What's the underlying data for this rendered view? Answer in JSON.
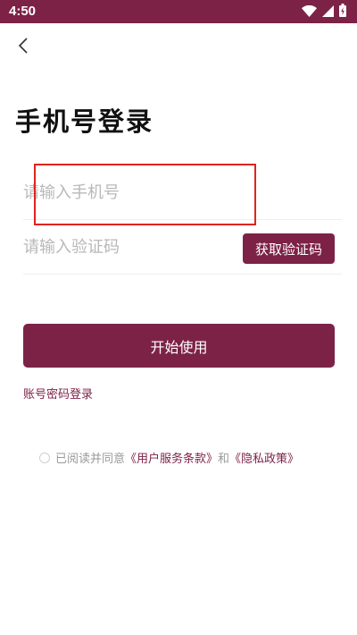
{
  "status_bar": {
    "time": "4:50"
  },
  "page": {
    "title": "手机号登录"
  },
  "phone_field": {
    "placeholder": "请输入手机号"
  },
  "code_field": {
    "placeholder": "请输入验证码",
    "send_button_label": "获取验证码"
  },
  "start_button_label": "开始使用",
  "password_login_label": "账号密码登录",
  "agreement": {
    "prefix": "已阅读并同意",
    "terms_link": "《用户服务条款》",
    "conjunction": "和",
    "privacy_link": "《隐私政策》"
  },
  "colors": {
    "brand": "#7d2247",
    "highlight": "#e0231c"
  },
  "icons": {
    "back": "back-arrow-icon",
    "wifi": "wifi-icon",
    "signal": "signal-icon",
    "battery": "battery-icon"
  }
}
